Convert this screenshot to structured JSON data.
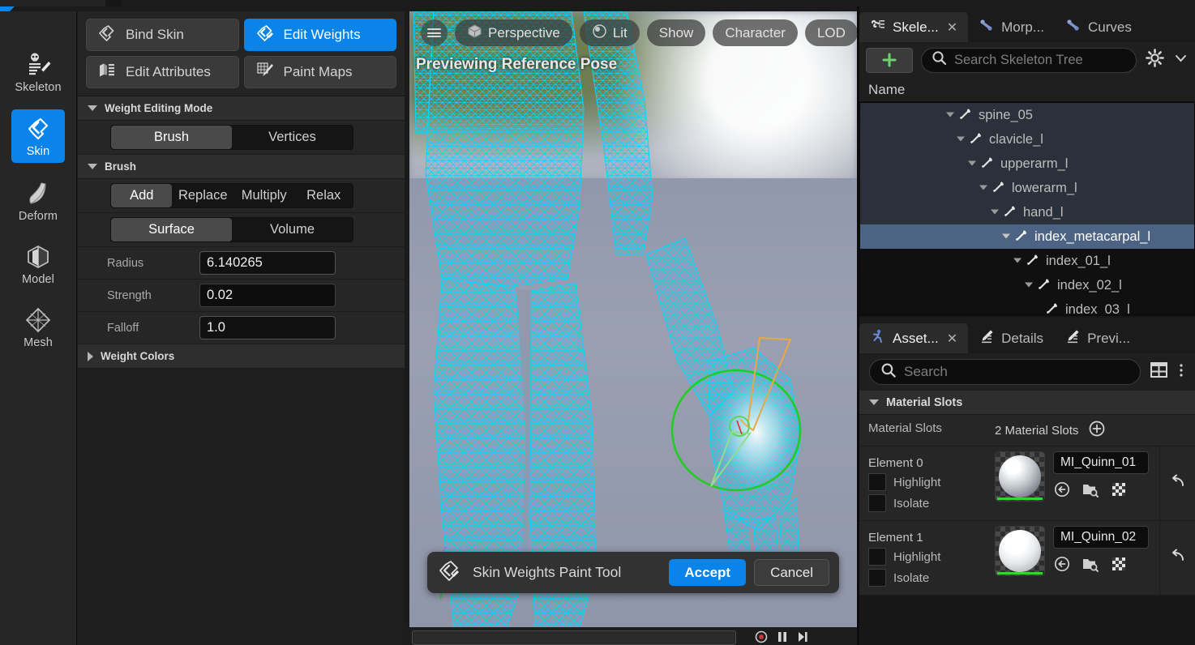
{
  "modes": {
    "items": [
      {
        "label": "Skeleton",
        "icon": "skeleton-icon",
        "active": false
      },
      {
        "label": "Skin",
        "icon": "skin-icon",
        "active": true
      },
      {
        "label": "Deform",
        "icon": "deform-icon",
        "active": false
      },
      {
        "label": "Model",
        "icon": "model-icon",
        "active": false
      },
      {
        "label": "Mesh",
        "icon": "mesh-icon",
        "active": false
      }
    ]
  },
  "tool_panel": {
    "buttons": [
      {
        "label": "Bind Skin",
        "icon": "bind-skin-icon",
        "active": false
      },
      {
        "label": "Edit Weights",
        "icon": "edit-weights-icon",
        "active": true
      },
      {
        "label": "Edit Attributes",
        "icon": "edit-attributes-icon",
        "active": false
      },
      {
        "label": "Paint Maps",
        "icon": "paint-maps-icon",
        "active": false
      }
    ],
    "weight_editing_mode": {
      "title": "Weight Editing Mode",
      "options": [
        "Brush",
        "Vertices"
      ],
      "selected": "Brush"
    },
    "brush": {
      "title": "Brush",
      "modes": [
        "Add",
        "Replace",
        "Multiply",
        "Relax"
      ],
      "mode_selected": "Add",
      "falloff_shape": [
        "Surface",
        "Volume"
      ],
      "falloff_shape_selected": "Surface",
      "properties": [
        {
          "label": "Radius",
          "value": "6.140265"
        },
        {
          "label": "Strength",
          "value": "0.02"
        },
        {
          "label": "Falloff",
          "value": "1.0"
        }
      ]
    },
    "weight_colors": {
      "title": "Weight Colors",
      "expanded": false
    }
  },
  "viewport": {
    "status_label": "Previewing Reference Pose",
    "toolbar": [
      {
        "label": "Perspective",
        "icon": "cube-icon"
      },
      {
        "label": "Lit",
        "icon": "lighting-icon"
      },
      {
        "label": "Show",
        "icon": ""
      },
      {
        "label": "Character",
        "icon": ""
      },
      {
        "label": "LOD",
        "icon": ""
      }
    ],
    "menu_icon": "hamburger-icon",
    "accept_bar": {
      "title": "Skin Weights Paint Tool",
      "icon": "skin-weights-paint-tool-icon",
      "accept_label": "Accept",
      "cancel_label": "Cancel"
    },
    "colors": {
      "wireframe": "#00d8ff",
      "brush_circle": "#22cc22",
      "gizmo_orange": "#e8a845",
      "background": "#9298ab"
    }
  },
  "skeleton_panel": {
    "tabs": [
      {
        "label": "Skele...",
        "icon": "skeleton-tree-icon",
        "active": true,
        "closable": true
      },
      {
        "label": "Morp...",
        "icon": "morph-target-icon",
        "active": false,
        "closable": false
      },
      {
        "label": "Curves",
        "icon": "curves-icon",
        "active": false,
        "closable": false
      }
    ],
    "add_button": "+",
    "search_placeholder": "Search Skeleton Tree",
    "settings_icon": "gear-icon",
    "chevron_icon": "chevron-down-icon",
    "column_header": "Name",
    "tree": [
      {
        "label": "spine_05",
        "depth": 5,
        "selected": false,
        "expander": true
      },
      {
        "label": "clavicle_l",
        "depth": 6,
        "selected": false,
        "expander": true
      },
      {
        "label": "upperarm_l",
        "depth": 7,
        "selected": false,
        "expander": true
      },
      {
        "label": "lowerarm_l",
        "depth": 8,
        "selected": false,
        "expander": true
      },
      {
        "label": "hand_l",
        "depth": 9,
        "selected": false,
        "expander": true
      },
      {
        "label": "index_metacarpal_l",
        "depth": 10,
        "selected": true,
        "expander": true
      },
      {
        "label": "index_01_l",
        "depth": 11,
        "selected": false,
        "expander": true
      },
      {
        "label": "index_02_l",
        "depth": 12,
        "selected": false,
        "expander": true
      },
      {
        "label": "index_03_l",
        "depth": 13,
        "selected": false,
        "expander": false
      }
    ]
  },
  "asset_panel": {
    "tabs": [
      {
        "label": "Asset...",
        "icon": "asset-details-icon",
        "active": true,
        "closable": true
      },
      {
        "label": "Details",
        "icon": "details-icon",
        "active": false,
        "closable": false
      },
      {
        "label": "Previ...",
        "icon": "preview-scene-icon",
        "active": false,
        "closable": false
      }
    ],
    "search_placeholder": "Search",
    "grid_icon": "grid-view-icon",
    "section_title": "Material Slots",
    "material_slots_row": {
      "label": "Material Slots",
      "value": "2 Material Slots",
      "add_icon": "plus-circle-icon"
    },
    "elements": [
      {
        "label": "Element 0",
        "highlight_label": "Highlight",
        "isolate_label": "Isolate",
        "highlight_checked": false,
        "isolate_checked": false,
        "material_name": "MI_Quinn_01",
        "thumb_color": "#c8ccd0",
        "icons": [
          "browse-to-asset-icon",
          "find-in-content-browser-icon",
          "use-selected-asset-icon"
        ],
        "reset_icon": "reset-arrow-icon"
      },
      {
        "label": "Element 1",
        "highlight_label": "Highlight",
        "isolate_label": "Isolate",
        "highlight_checked": false,
        "isolate_checked": false,
        "material_name": "MI_Quinn_02",
        "thumb_color": "#e6e8ea",
        "icons": [
          "browse-to-asset-icon",
          "find-in-content-browser-icon",
          "use-selected-asset-icon"
        ],
        "reset_icon": "reset-arrow-icon"
      }
    ]
  }
}
